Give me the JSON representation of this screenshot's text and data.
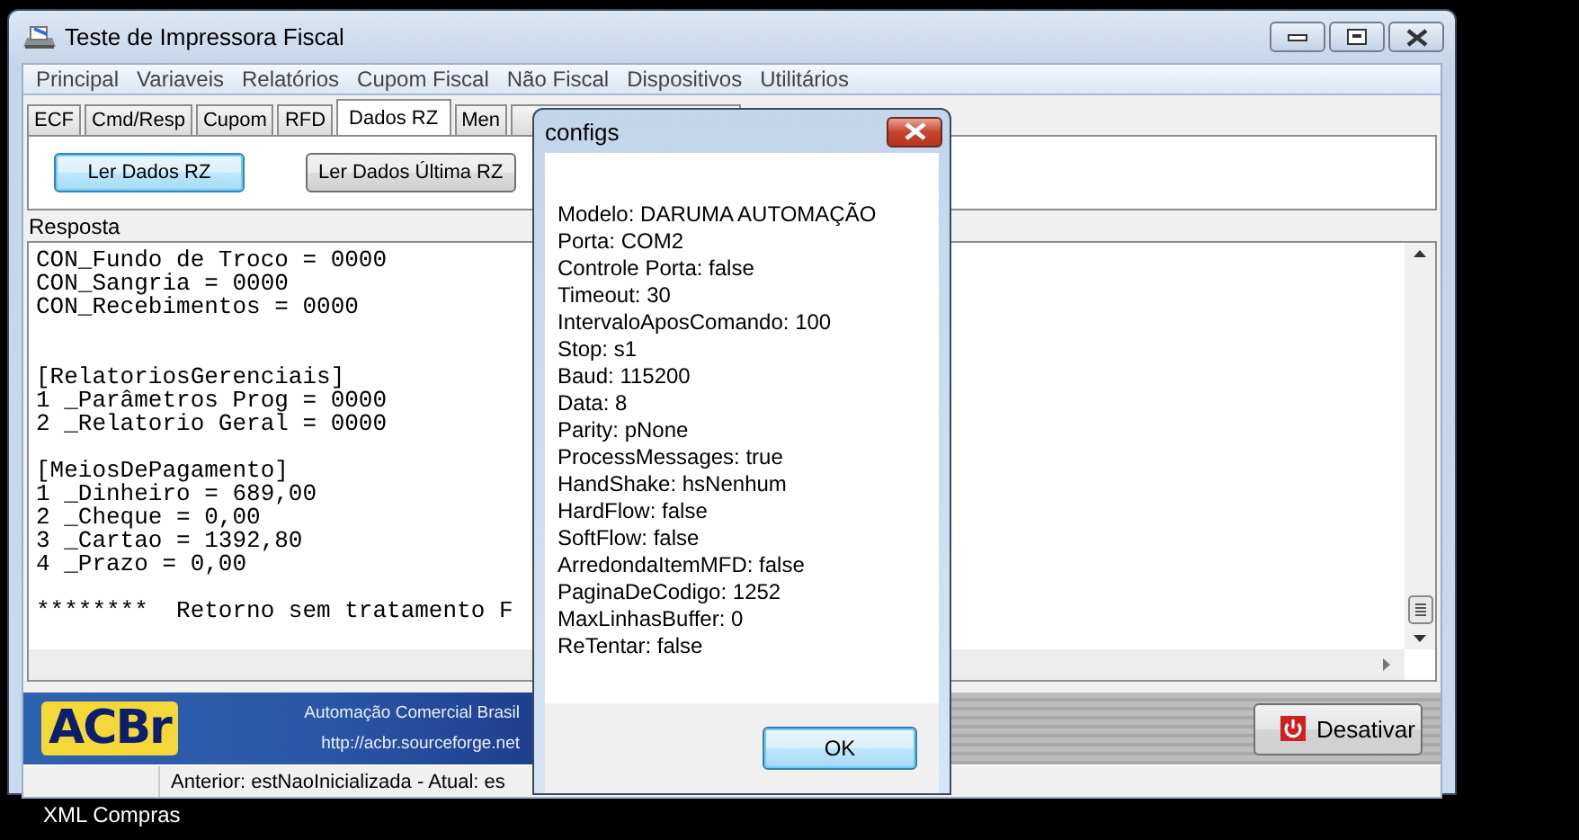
{
  "desktop_label": "XML Compras",
  "window": {
    "title": "Teste de Impressora Fiscal"
  },
  "menu": [
    "Principal",
    "Variaveis",
    "Relatórios",
    "Cupom Fiscal",
    "Não Fiscal",
    "Dispositivos",
    "Utilitários"
  ],
  "tabs": [
    {
      "label": "ECF",
      "selected": false
    },
    {
      "label": "Cmd/Resp",
      "selected": false
    },
    {
      "label": "Cupom",
      "selected": false
    },
    {
      "label": "RFD",
      "selected": false
    },
    {
      "label": "Dados RZ",
      "selected": true
    },
    {
      "label": "Men",
      "selected": false
    }
  ],
  "buttons": [
    {
      "label": "Ler Dados RZ",
      "focused": true
    },
    {
      "label": "Ler Dados Última RZ",
      "focused": false
    }
  ],
  "response": {
    "label": "Resposta",
    "text": "CON_Fundo de Troco = 0000\nCON_Sangria = 0000\nCON_Recebimentos = 0000\n\n\n[RelatoriosGerenciais]\n1 _Parâmetros Prog = 0000\n2 _Relatorio Geral = 0000\n\n[MeiosDePagamento]\n1 _Dinheiro = 689,00\n2 _Cheque = 0,00\n3 _Cartao = 1392,80\n4 _Prazo = 0,00\n\n********  Retorno sem tratamento F"
  },
  "banner": {
    "logo": "ACBr",
    "tagline": "Automação Comercial Brasil",
    "url": "http://acbr.sourceforge.net"
  },
  "deactivate_button": "Desativar",
  "status_bar": {
    "state": "Anterior: estNaoInicializada - Atual: es"
  },
  "dialog": {
    "title": "configs",
    "lines": [
      "Modelo: DARUMA AUTOMAÇÃO",
      "Porta: COM2",
      "Controle Porta: false",
      "Timeout: 30",
      "IntervaloAposComando: 100",
      "Stop: s1",
      "Baud: 115200",
      "Data: 8",
      "Parity: pNone",
      "ProcessMessages: true",
      "HandShake: hsNenhum",
      "HardFlow: false",
      "SoftFlow: false",
      "ArredondaItemMFD: false",
      "PaginaDeCodigo: 1252",
      "MaxLinhasBuffer: 0",
      "ReTentar: false"
    ],
    "button": "OK"
  }
}
